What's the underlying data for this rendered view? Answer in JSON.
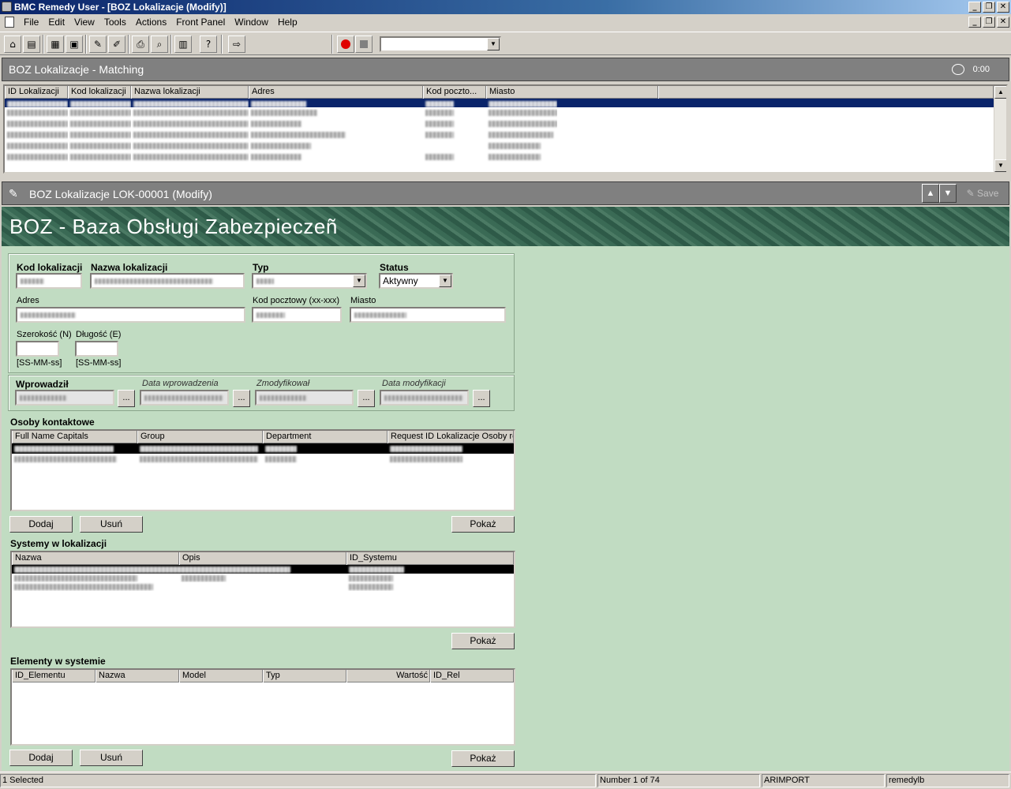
{
  "window": {
    "title": "BMC Remedy User - [BOZ Lokalizacje (Modify)]",
    "minimize_glyph": "_",
    "restore_glyph": "❐",
    "close_glyph": "✕"
  },
  "menu": {
    "items": [
      "File",
      "Edit",
      "View",
      "Tools",
      "Actions",
      "Front Panel",
      "Window",
      "Help"
    ]
  },
  "matching": {
    "title": "BOZ Lokalizacje - Matching",
    "timer": "0:00",
    "columns": [
      "ID Lokalizacji",
      "Kod lokalizacji",
      "Nazwa lokalizacji",
      "Adres",
      "Kod poczto...",
      "Miasto"
    ],
    "row_count": 7
  },
  "form": {
    "header_title": "BOZ Lokalizacje LOK-00001 (Modify)",
    "save_label": "Save",
    "banner_title": "BOZ - Baza Obsługi Zabezpieczeñ",
    "labels": {
      "kod_lokalizacji": "Kod lokalizacji",
      "nazwa_lokalizacji": "Nazwa lokalizacji",
      "typ": "Typ",
      "status": "Status",
      "adres": "Adres",
      "kod_pocztowy": "Kod pocztowy (xx-xxx)",
      "miasto": "Miasto",
      "szerokosc": "Szerokość (N)",
      "dlugosc": "Długość (E)",
      "ss_mm_ss_1": "[SS-MM-ss]",
      "ss_mm_ss_2": "[SS-MM-ss]",
      "wprowadzil": "Wprowadził",
      "data_wprowadzenia": "Data wprowadzenia",
      "zmodyfikowal": "Zmodyfikował",
      "data_modyfikacji": "Data modyfikacji"
    },
    "status_value": "Aktywny",
    "ellipsis": "..."
  },
  "osoby": {
    "title": "Osoby kontaktowe",
    "columns": [
      "Full Name Capitals",
      "Group",
      "Department",
      "Request ID Lokalizacje Osoby rel"
    ],
    "buttons": {
      "add": "Dodaj",
      "remove": "Usuń",
      "show": "Pokaż"
    }
  },
  "systemy": {
    "title": "Systemy w lokalizacji",
    "columns": [
      "Nazwa",
      "Opis",
      "ID_Systemu"
    ],
    "buttons": {
      "show": "Pokaż"
    }
  },
  "elementy": {
    "title": "Elementy w systemie",
    "columns": [
      "ID_Elementu",
      "Nazwa",
      "Model",
      "Typ",
      "Wartość",
      "ID_Rel"
    ],
    "buttons": {
      "add": "Dodaj",
      "remove": "Usuń",
      "show": "Pokaż"
    }
  },
  "statusbar": {
    "selected": "1 Selected",
    "record": "Number 1 of 74",
    "server": "ARIMPORT",
    "user": "remedylb"
  },
  "colors": {
    "form_background": "#c1dcc2",
    "section_bar": "#808080",
    "selection": "#0a246a",
    "record_button": "#e00000"
  }
}
